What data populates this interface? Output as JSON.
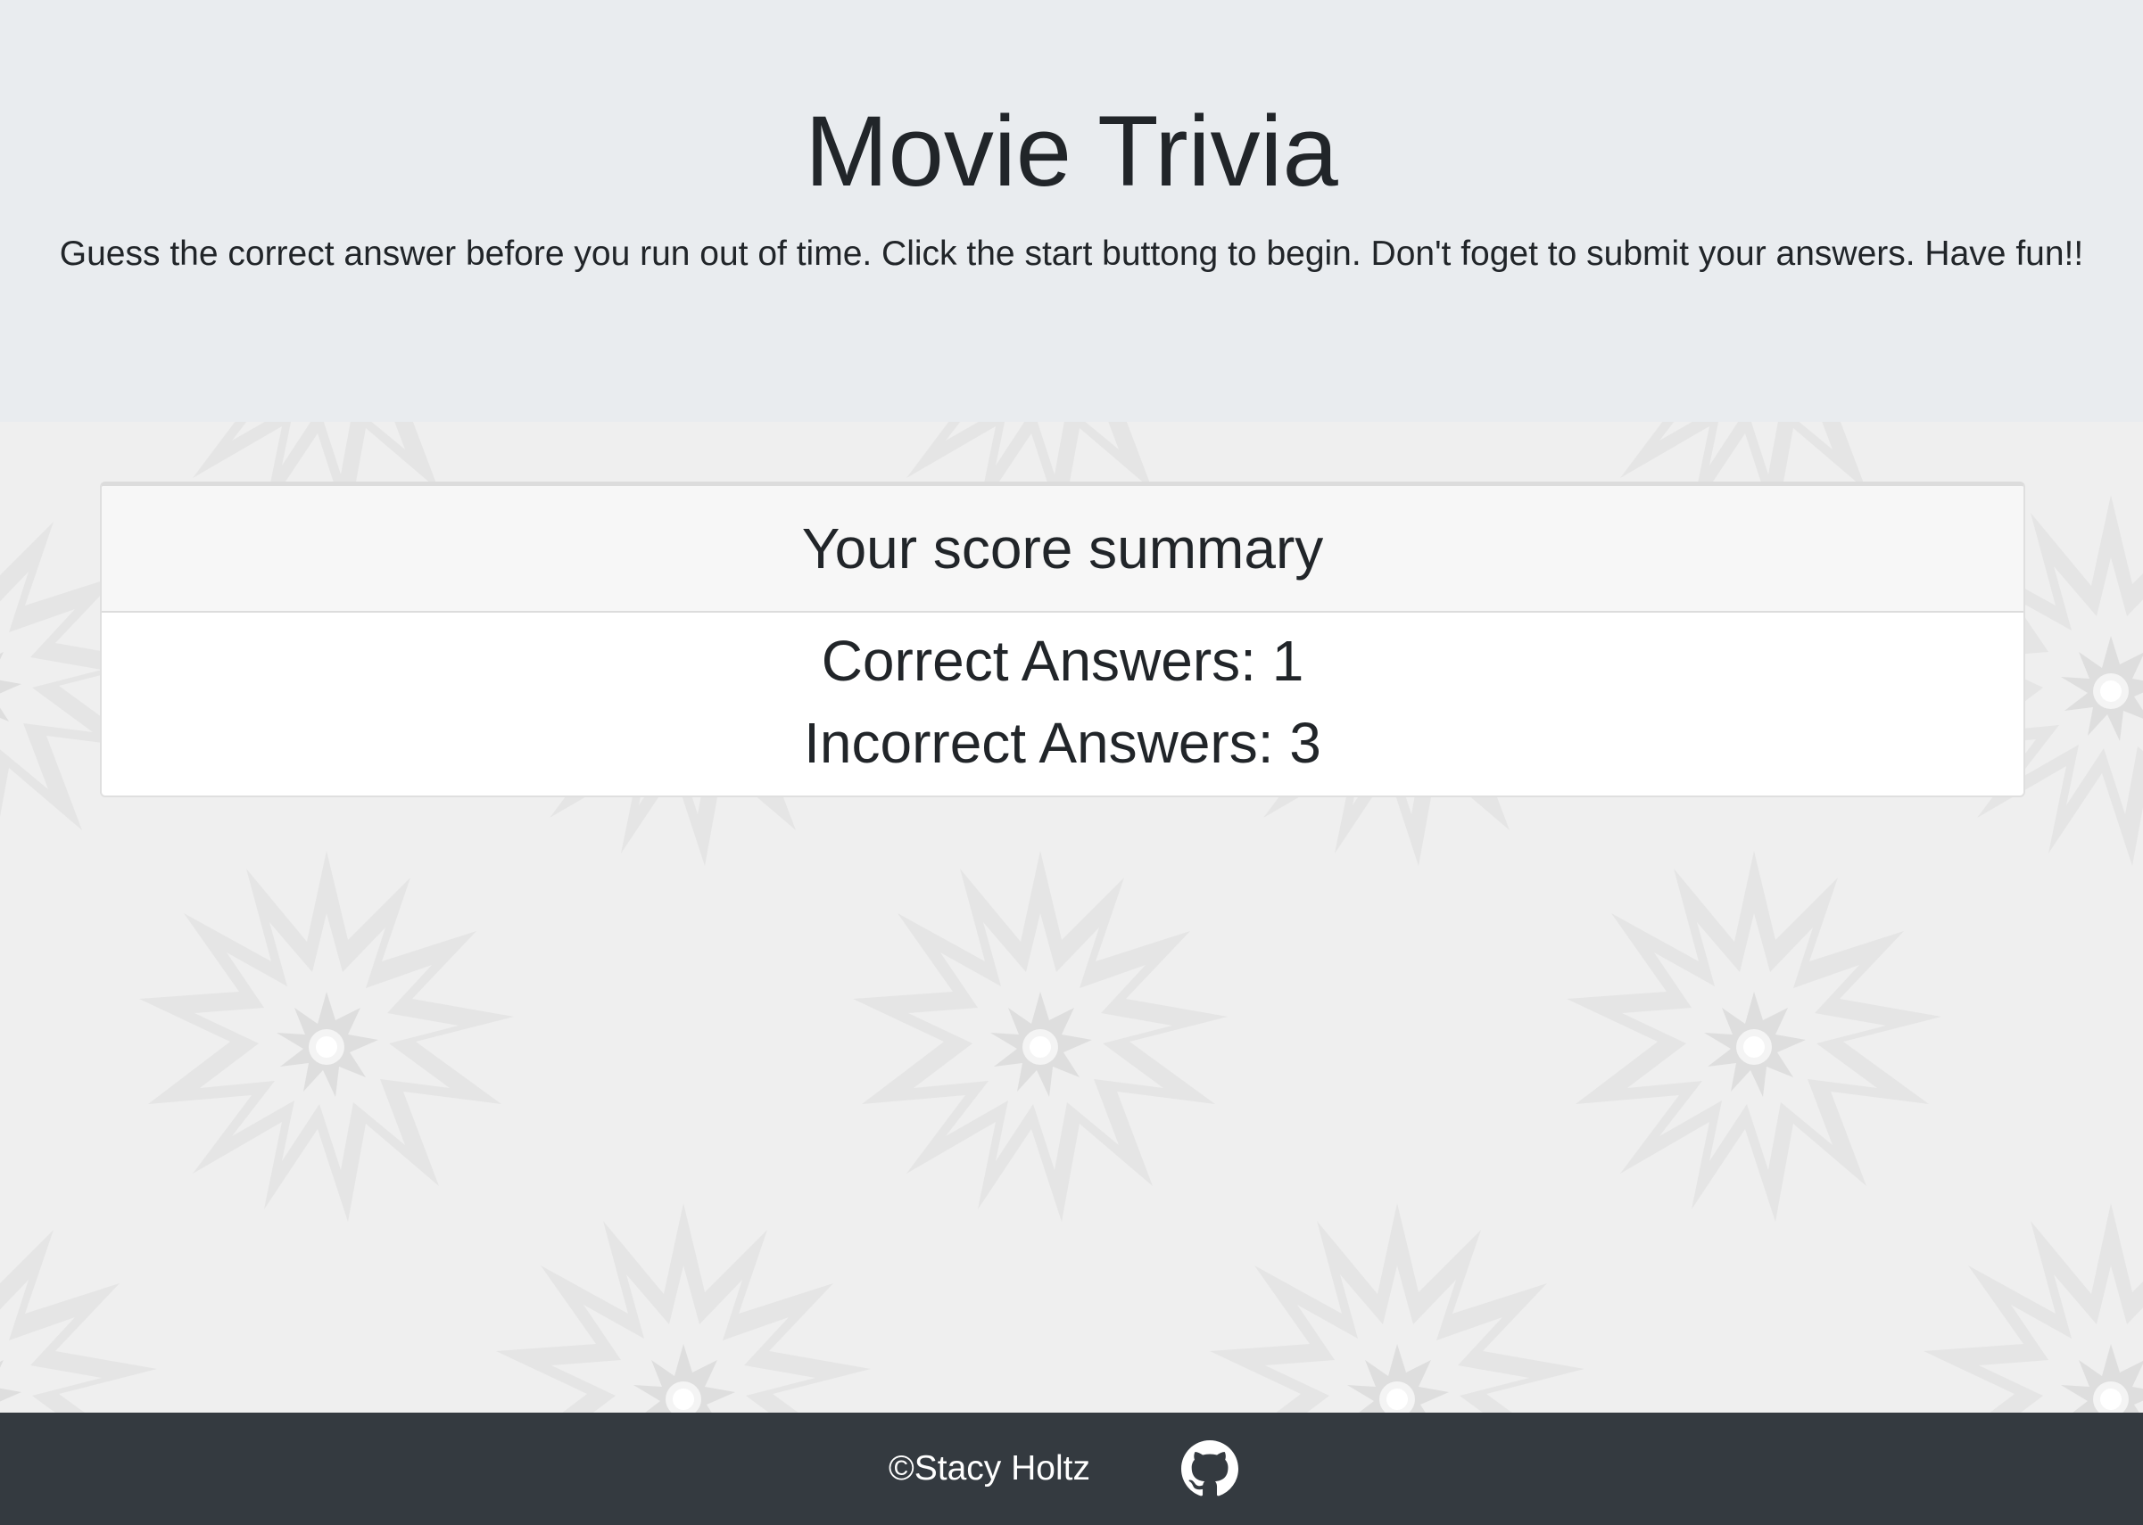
{
  "header": {
    "title": "Movie Trivia",
    "subtitle": "Guess the correct answer before you run out of time. Click the start buttong to begin. Don't foget to submit your answers. Have fun!!"
  },
  "score_card": {
    "title": "Your score summary",
    "correct_label": "Correct Answers:",
    "correct_value": "1",
    "incorrect_label": "Incorrect Answers:",
    "incorrect_value": "3"
  },
  "footer": {
    "copyright": "©Stacy Holtz",
    "github_icon": "github-icon"
  },
  "colors": {
    "header_bg": "#e9ecef",
    "page_bg": "#efefef",
    "footer_bg": "#343a40",
    "text": "#212529"
  }
}
